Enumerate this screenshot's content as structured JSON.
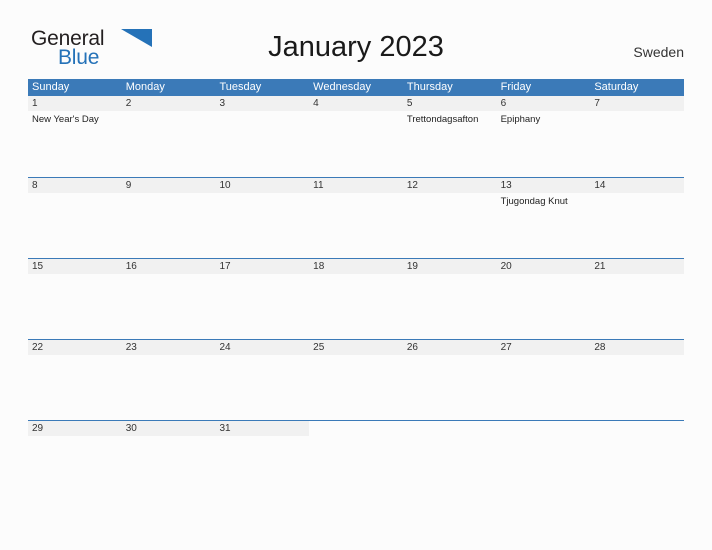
{
  "brand": {
    "name_top": "General",
    "name_bottom": "Blue",
    "flag_icon": "blue-flag-triangle-icon",
    "color_top": "#231f20",
    "color_bottom": "#2572b8"
  },
  "header": {
    "title": "January 2023",
    "country": "Sweden"
  },
  "theme": {
    "header_blue": "#3b7ab8",
    "date_band_gray": "#f1f1f1",
    "page_background": "#fcfcfc",
    "text_color": "#333333"
  },
  "calendar": {
    "month": "January",
    "year": "2023",
    "weekdays": [
      "Sunday",
      "Monday",
      "Tuesday",
      "Wednesday",
      "Thursday",
      "Friday",
      "Saturday"
    ],
    "weeks": [
      [
        {
          "date": "1",
          "events": [
            "New Year's Day"
          ]
        },
        {
          "date": "2",
          "events": []
        },
        {
          "date": "3",
          "events": []
        },
        {
          "date": "4",
          "events": []
        },
        {
          "date": "5",
          "events": [
            "Trettondagsafton"
          ]
        },
        {
          "date": "6",
          "events": [
            "Epiphany"
          ]
        },
        {
          "date": "7",
          "events": []
        }
      ],
      [
        {
          "date": "8",
          "events": []
        },
        {
          "date": "9",
          "events": []
        },
        {
          "date": "10",
          "events": []
        },
        {
          "date": "11",
          "events": []
        },
        {
          "date": "12",
          "events": []
        },
        {
          "date": "13",
          "events": [
            "Tjugondag Knut"
          ]
        },
        {
          "date": "14",
          "events": []
        }
      ],
      [
        {
          "date": "15",
          "events": []
        },
        {
          "date": "16",
          "events": []
        },
        {
          "date": "17",
          "events": []
        },
        {
          "date": "18",
          "events": []
        },
        {
          "date": "19",
          "events": []
        },
        {
          "date": "20",
          "events": []
        },
        {
          "date": "21",
          "events": []
        }
      ],
      [
        {
          "date": "22",
          "events": []
        },
        {
          "date": "23",
          "events": []
        },
        {
          "date": "24",
          "events": []
        },
        {
          "date": "25",
          "events": []
        },
        {
          "date": "26",
          "events": []
        },
        {
          "date": "27",
          "events": []
        },
        {
          "date": "28",
          "events": []
        }
      ],
      [
        {
          "date": "29",
          "events": []
        },
        {
          "date": "30",
          "events": []
        },
        {
          "date": "31",
          "events": []
        },
        {
          "date": "",
          "events": []
        },
        {
          "date": "",
          "events": []
        },
        {
          "date": "",
          "events": []
        },
        {
          "date": "",
          "events": []
        }
      ]
    ]
  }
}
